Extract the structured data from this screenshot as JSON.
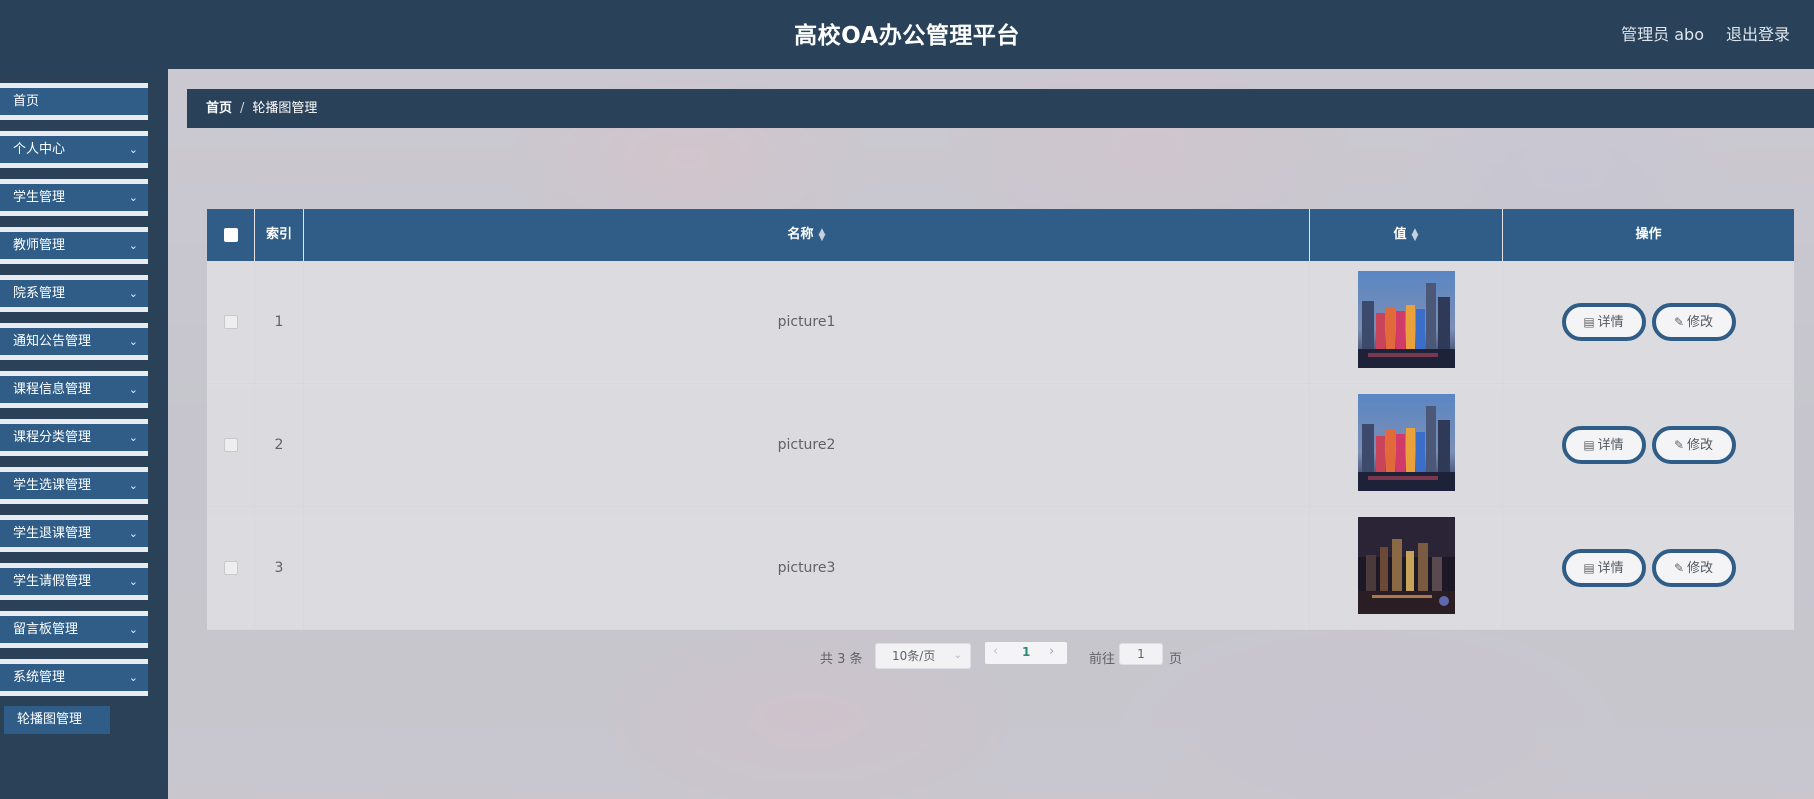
{
  "header": {
    "title": "高校OA办公管理平台",
    "user": "管理员 abo",
    "logout": "退出登录"
  },
  "sidebar": {
    "items": [
      {
        "label": "首页"
      },
      {
        "label": "个人中心"
      },
      {
        "label": "学生管理"
      },
      {
        "label": "教师管理"
      },
      {
        "label": "院系管理"
      },
      {
        "label": "通知公告管理"
      },
      {
        "label": "课程信息管理"
      },
      {
        "label": "课程分类管理"
      },
      {
        "label": "学生选课管理"
      },
      {
        "label": "学生退课管理"
      },
      {
        "label": "学生请假管理"
      },
      {
        "label": "留言板管理"
      },
      {
        "label": "系统管理"
      }
    ],
    "submenu": "轮播图管理"
  },
  "breadcrumb": {
    "home": "首页",
    "separator": "/",
    "current": "轮播图管理"
  },
  "table": {
    "headers": {
      "index": "索引",
      "name": "名称",
      "value": "值",
      "action": "操作"
    },
    "rows": [
      {
        "index": "1",
        "name": "picture1"
      },
      {
        "index": "2",
        "name": "picture2"
      },
      {
        "index": "3",
        "name": "picture3"
      }
    ],
    "detail_label": "详情",
    "edit_label": "修改"
  },
  "pagination": {
    "total": "共 3 条",
    "page_size": "10条/页",
    "current_page": "1",
    "goto_label": "前往",
    "goto_value": "1",
    "page_label": "页"
  },
  "colors": {
    "header_bg": "#29425a",
    "primary": "#2f5d87",
    "active_page": "#2f8a7a"
  }
}
